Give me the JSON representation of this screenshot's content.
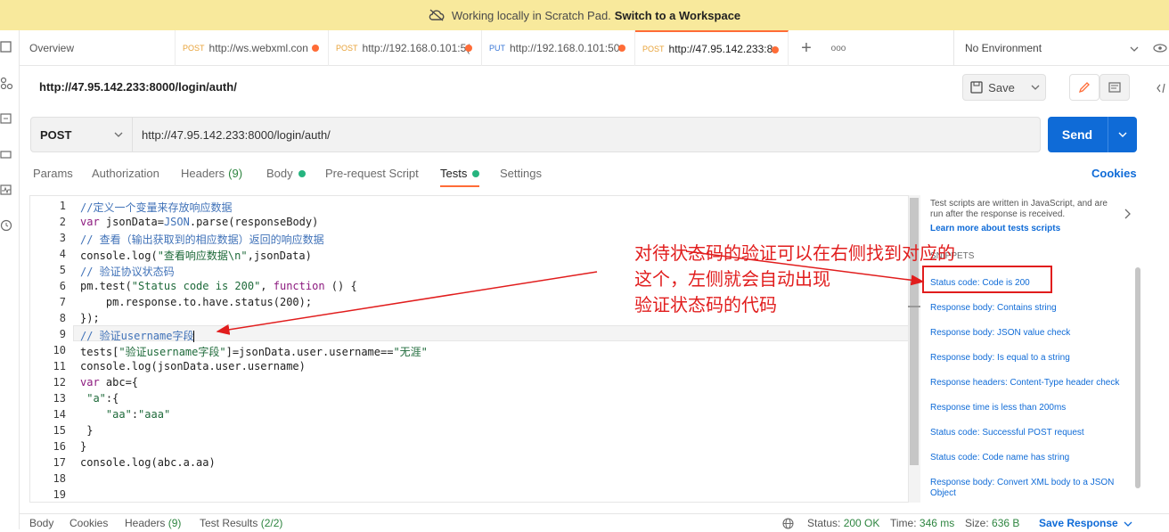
{
  "banner": {
    "text": "Working locally in Scratch Pad.",
    "link": "Switch to a Workspace"
  },
  "tabs": [
    {
      "label": "Overview"
    },
    {
      "method": "POST",
      "label": "http://ws.webxml.con"
    },
    {
      "method": "POST",
      "label": "http://192.168.0.101:5("
    },
    {
      "method": "PUT",
      "label": "http://192.168.0.101:50"
    },
    {
      "method": "POST",
      "label": "http://47.95.142.233:8"
    }
  ],
  "tab_tools": {
    "new": "+",
    "more": "ooo"
  },
  "environment": {
    "label": "No Environment"
  },
  "request": {
    "title": "http://47.95.142.233:8000/login/auth/",
    "method": "POST",
    "url": "http://47.95.142.233:8000/login/auth/",
    "save_label": "Save",
    "send_label": "Send"
  },
  "request_tabs": [
    {
      "label": "Params"
    },
    {
      "label": "Authorization"
    },
    {
      "label": "Headers",
      "count": "(9)"
    },
    {
      "label": "Body"
    },
    {
      "label": "Pre-request Script"
    },
    {
      "label": "Tests"
    },
    {
      "label": "Settings"
    }
  ],
  "cookies_label": "Cookies",
  "editor": {
    "line_numbers": [
      "1",
      "2",
      "3",
      "4",
      "5",
      "6",
      "7",
      "8",
      "9",
      "10",
      "11",
      "12",
      "13",
      "14",
      "15",
      "16",
      "17",
      "18",
      "19"
    ],
    "lines": {
      "l1": "//定义一个变量来存放响应数据",
      "l2a": "var",
      "l2b": " jsonData=",
      "l2c": "JSON",
      "l2d": ".parse(responseBody)",
      "l3": "// 查看（输出获取到的相应数据）返回的响应数据",
      "l4a": "console.log(",
      "l4b": "\"查看响应数据\\n\"",
      "l4c": ",jsonData)",
      "l5": "// 验证协议状态码",
      "l6a": "pm.test(",
      "l6b": "\"Status code is 200\"",
      "l6c": ", ",
      "l6d": "function",
      "l6e": " () {",
      "l7": "    pm.response.to.have.status(200);",
      "l8": "});",
      "l9": "// 验证username字段",
      "l10a": "tests[",
      "l10b": "\"验证username字段\"",
      "l10c": "]=jsonData.user.username==",
      "l10d": "\"无涯\"",
      "l11": "console.log(jsonData.user.username)",
      "l12a": "var",
      "l12b": " abc={",
      "l13a": " ",
      "l13b": "\"a\"",
      "l13c": ":{",
      "l14a": "    ",
      "l14b": "\"aa\"",
      "l14c": ":",
      "l14d": "\"aaa\"",
      "l15": " }",
      "l16": "}",
      "l17": "console.log(abc.a.aa)",
      "l18": "",
      "l19": ""
    }
  },
  "snippets": {
    "intro": "Test scripts are written in JavaScript, and are run after the response is received.",
    "learn_more": "Learn more about tests scripts",
    "heading": "SNIPPETS",
    "items": [
      "Status code: Code is 200",
      "Response body: Contains string",
      "Response body: JSON value check",
      "Response body: Is equal to a string",
      "Response headers: Content-Type header check",
      "Response time is less than 200ms",
      "Status code: Successful POST request",
      "Status code: Code name has string",
      "Response body: Convert XML body to a JSON Object"
    ]
  },
  "annotation": {
    "line1": "对待状态码的验证可以在右侧找到对应的",
    "line2": "这个，左侧就会自动出现",
    "line3": "验证状态码的代码"
  },
  "response_bar": {
    "body": "Body",
    "cookies": "Cookies",
    "headers": "Headers",
    "headers_count": "(9)",
    "test_results": "Test Results",
    "test_results_count": "(2/2)",
    "status_label": "Status:",
    "status_value": "200 OK",
    "time_label": "Time:",
    "time_value": "346 ms",
    "size_label": "Size:",
    "size_value": "636 B",
    "save_response": "Save Response"
  },
  "colors": {
    "accent": "#ff6c37",
    "send": "#0f6bd7",
    "banner": "#f8e99c",
    "annotation": "#e11d1d",
    "green": "#26b47f"
  }
}
